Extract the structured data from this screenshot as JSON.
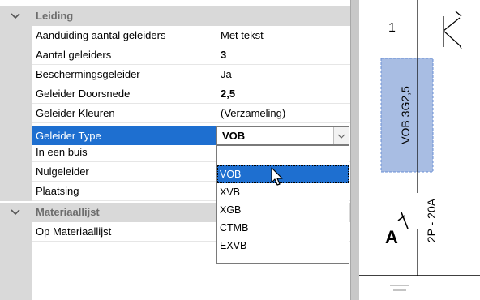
{
  "property_grid": {
    "category_leiding": "Leiding",
    "category_materiaallijst": "Materiaallijst",
    "rows": [
      {
        "name": "Aanduiding aantal geleiders",
        "value": "Met tekst",
        "bold": false
      },
      {
        "name": "Aantal geleiders",
        "value": "3",
        "bold": true
      },
      {
        "name": "Beschermingsgeleider",
        "value": "Ja",
        "bold": false
      },
      {
        "name": "Geleider Doorsnede",
        "value": "2,5",
        "bold": true
      },
      {
        "name": "Geleider Kleuren",
        "value": "(Verzameling)",
        "bold": false
      },
      {
        "name": "Geleider Type",
        "value": "VOB",
        "bold": true
      },
      {
        "name": "In een buis",
        "value": "",
        "bold": false
      },
      {
        "name": "Nulgeleider",
        "value": "",
        "bold": false
      },
      {
        "name": "Plaatsing",
        "value": "",
        "bold": false
      }
    ],
    "materiaallijst_rows": [
      {
        "name": "Op Materiaallijst",
        "value": ""
      }
    ],
    "selected_row": "Geleider Type"
  },
  "dropdown": {
    "selected_value": "VOB",
    "options": [
      "VOB",
      "XVB",
      "XGB",
      "CTMB",
      "EXVB"
    ],
    "highlighted": "VOB"
  },
  "drawing": {
    "number_label": "1",
    "cable_label": "VOB 3G2,5",
    "breaker_label": "2P - 20A",
    "breaker_letter": "A"
  },
  "icons": [
    "chevron-down-icon",
    "dropdown-arrow-icon",
    "mouse-cursor-icon"
  ],
  "colors": {
    "selection": "#1e6fd0",
    "cable_box": "#a8bde3",
    "gutter": "#d9d9d9"
  }
}
